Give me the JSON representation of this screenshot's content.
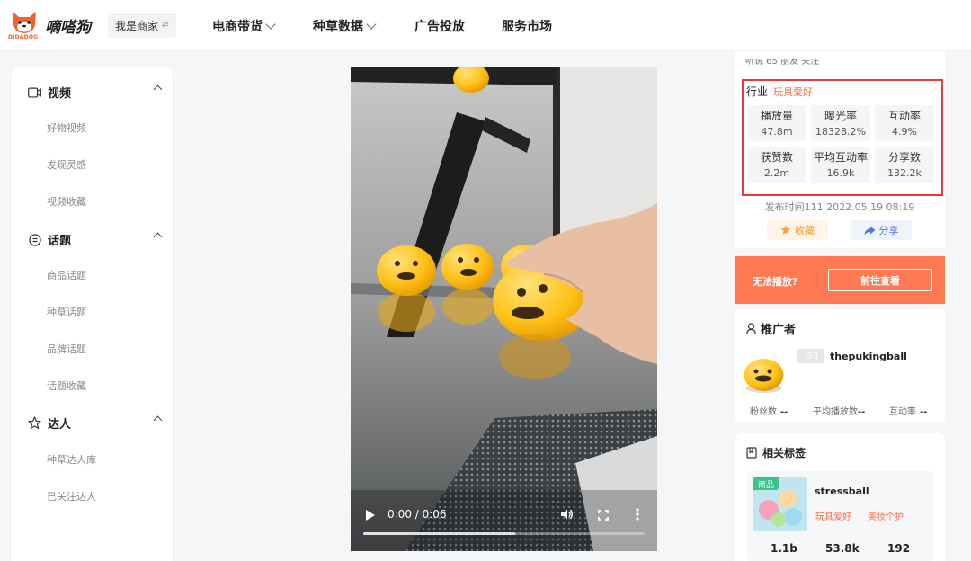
{
  "header": {
    "logo_text": "嘀嗒狗",
    "logo_sub": "DIDADOG",
    "role_switch": "我是商家",
    "role_switch_icon": "⇄",
    "nav": [
      "电商带货",
      "种草数据",
      "广告投放",
      "服务市场"
    ]
  },
  "sidebar": {
    "sections": [
      {
        "title": "视频",
        "icon": "video-icon",
        "items": [
          "好物视频",
          "发现灵感",
          "视频收藏"
        ]
      },
      {
        "title": "话题",
        "icon": "topic-icon",
        "items": [
          "商品话题",
          "种草话题",
          "品牌话题",
          "话题收藏"
        ]
      },
      {
        "title": "达人",
        "icon": "star-icon",
        "items": [
          "种草达人库",
          "已关注达人"
        ]
      }
    ]
  },
  "video": {
    "time": "0:00 / 0:06",
    "buffered_fraction": 0.54
  },
  "details": {
    "cut_text": "听说 65 朋友 关注",
    "industry_label": "行业",
    "industry_tag": "玩具爱好",
    "stats": [
      {
        "label": "播放量",
        "value": "47.8m"
      },
      {
        "label": "曝光率",
        "value": "18328.2%"
      },
      {
        "label": "互动率",
        "value": "4.9%"
      },
      {
        "label": "获赞数",
        "value": "2.2m"
      },
      {
        "label": "平均互动率",
        "value": "16.9k"
      },
      {
        "label": "分享数",
        "value": "132.2k"
      }
    ],
    "publish_time": "发布时间111 2022.05.19 08:19",
    "fav_label": "收藏",
    "share_label": "分享",
    "highlight_color": "#e83a3a"
  },
  "cant_play": {
    "message": "无法播放?",
    "button": "前往查看",
    "bg_color": "#ff7a52"
  },
  "promoter": {
    "title": "推广者",
    "level": "-93",
    "name": "thepukingball",
    "stats": [
      {
        "label": "粉丝数",
        "value": "--"
      },
      {
        "label": "平均播放数",
        "value": "--"
      },
      {
        "label": "互动率",
        "value": "--"
      }
    ]
  },
  "tags": {
    "title": "相关标签",
    "badge": "商品",
    "name": "stressball",
    "categories": [
      "玩具爱好",
      "美妆个护"
    ],
    "numbers": [
      "1.1b",
      "53.8k",
      "192"
    ]
  }
}
